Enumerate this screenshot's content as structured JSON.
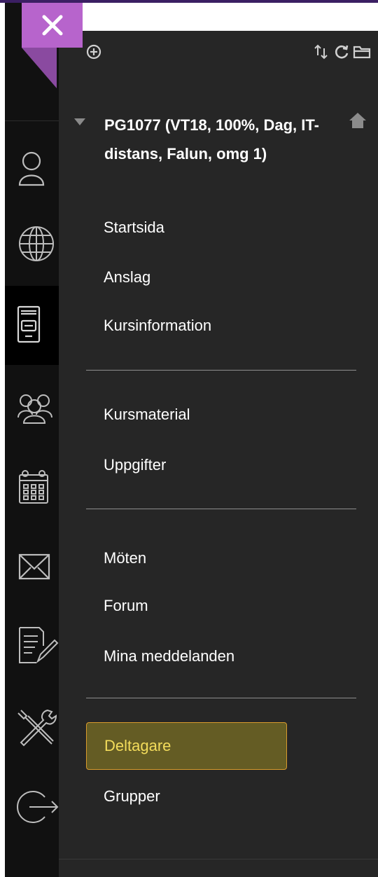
{
  "colors": {
    "close_tab": "#b764cc",
    "close_tab_fold": "#8a4aa0",
    "rail_background": "#111111",
    "panel_background": "#262626",
    "selected_background": "#645c24",
    "selected_border": "#d89a2d",
    "selected_text": "#f3dc5b",
    "text": "#ffffff",
    "icon": "#bdbdbd"
  },
  "close_button": {
    "icon": "close-icon"
  },
  "toolbar": {
    "icons": [
      "add-circle-icon",
      "sort-icon",
      "refresh-icon",
      "folder-icon"
    ]
  },
  "rail": {
    "icons": [
      "user-icon",
      "globe-icon",
      "course-icon",
      "groups-icon",
      "calendar-icon",
      "mail-icon",
      "edit-document-icon",
      "tools-icon",
      "logout-icon"
    ],
    "active": "course-icon"
  },
  "course": {
    "title": "PG1077 (VT18, 100%, Dag, IT-distans, Falun, omg 1)",
    "caret_icon": "caret-down-icon",
    "home_icon": "home-icon"
  },
  "menu": {
    "section1": [
      "Startsida",
      "Anslag",
      "Kursinformation"
    ],
    "section2": [
      "Kursmaterial",
      "Uppgifter"
    ],
    "section3": [
      "Möten",
      "Forum",
      "Mina meddelanden"
    ],
    "section4": [
      "Deltagare",
      "Grupper"
    ],
    "selected": "Deltagare"
  }
}
